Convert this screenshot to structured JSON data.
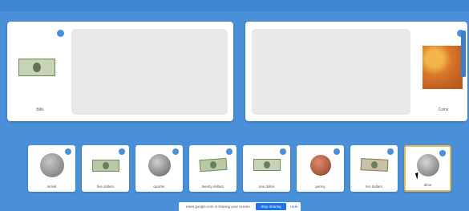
{
  "top_bar": {
    "title": "",
    "account": ""
  },
  "panels": [
    {
      "label": "Bills"
    },
    {
      "label": "Coins"
    }
  ],
  "info_icon_glyph": "●",
  "cards": [
    {
      "label": "nickel",
      "kind": "coin",
      "color": "#8a8a8a"
    },
    {
      "label": "five dollars",
      "kind": "bill"
    },
    {
      "label": "quarter",
      "kind": "coin",
      "color": "#9a9a9a"
    },
    {
      "label": "twenty dollars",
      "kind": "bill"
    },
    {
      "label": "one dollar",
      "kind": "bill"
    },
    {
      "label": "penny",
      "kind": "coin",
      "color": "#b5543b"
    },
    {
      "label": "ten dollars",
      "kind": "bill"
    },
    {
      "label": "dime",
      "kind": "coin",
      "color": "#999999",
      "selected": true
    }
  ],
  "share_bar": {
    "message": "meet.google.com is sharing your screen.",
    "stop_label": "Stop sharing",
    "hide_label": "Hide"
  },
  "colors": {
    "background": "#4a90d9",
    "accent": "#1a73e8",
    "selected_border": "#e6b84f"
  }
}
